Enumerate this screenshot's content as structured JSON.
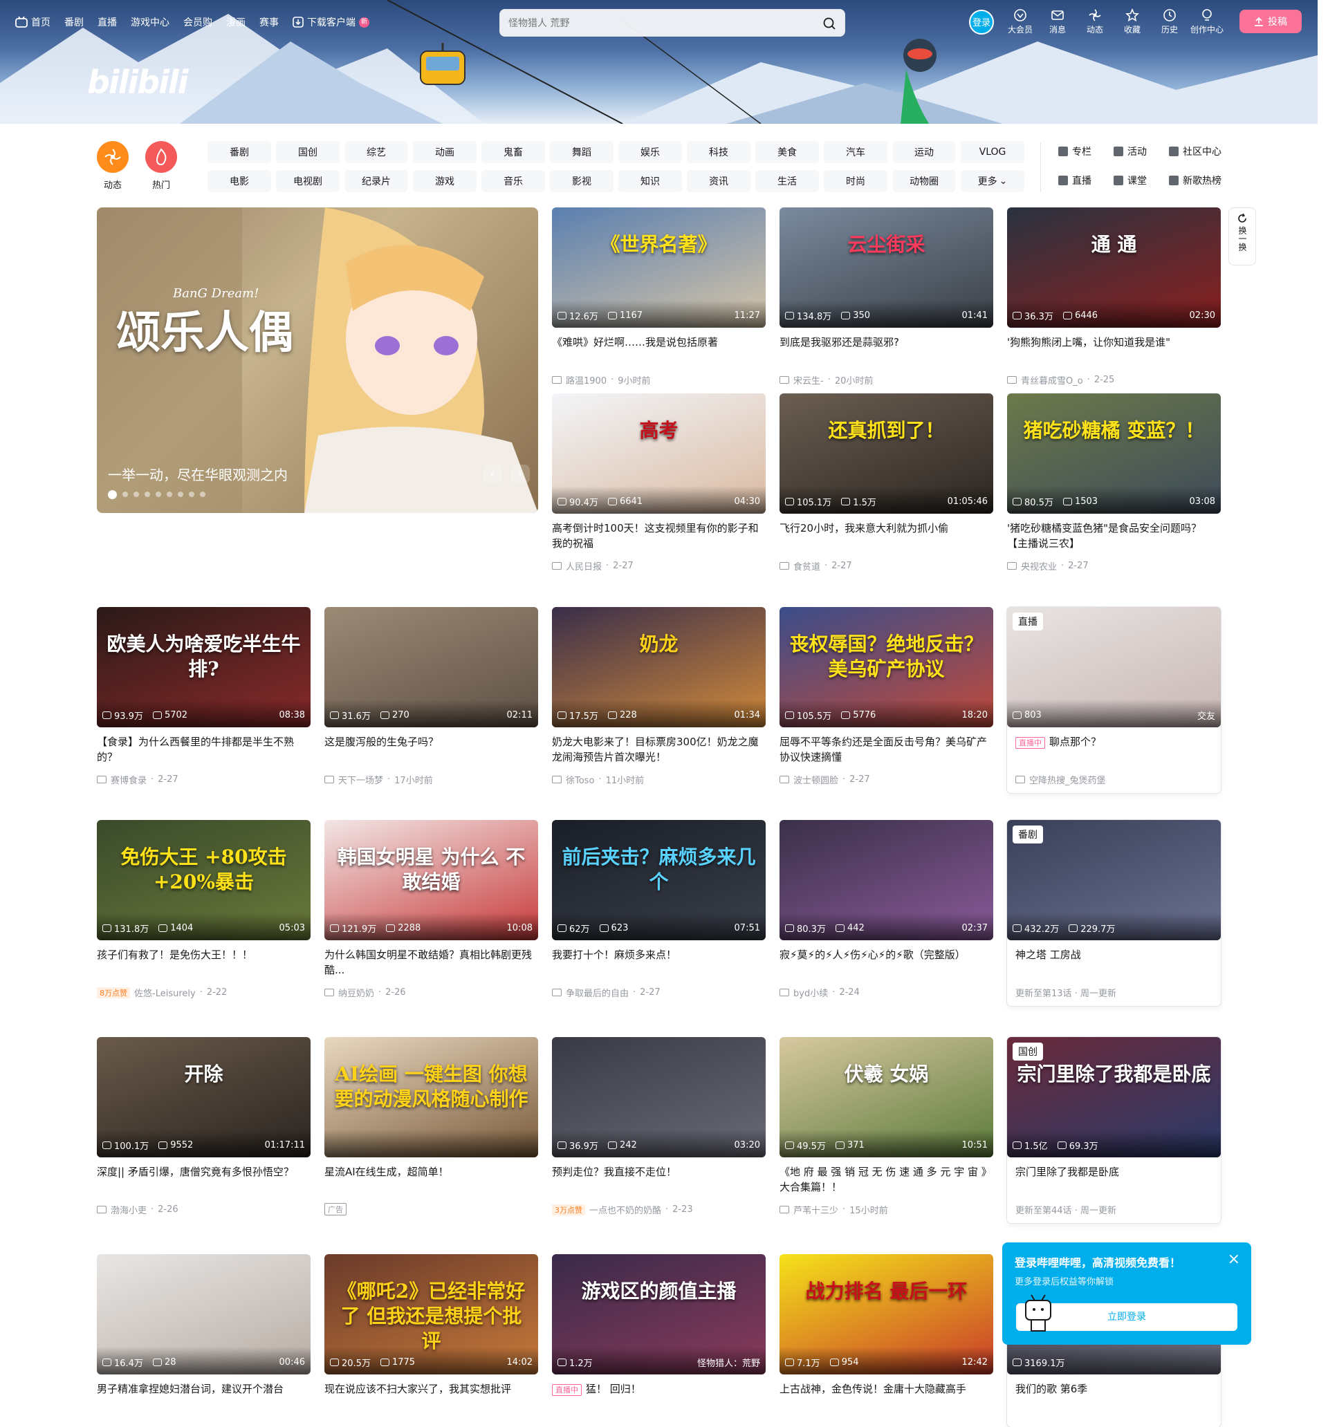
{
  "topnav": {
    "left": [
      {
        "label": "首页",
        "icon": "home-icon"
      },
      {
        "label": "番剧"
      },
      {
        "label": "直播"
      },
      {
        "label": "游戏中心"
      },
      {
        "label": "会员购"
      },
      {
        "label": "漫画"
      },
      {
        "label": "赛事"
      },
      {
        "label": "下载客户端",
        "icon": "download-icon",
        "badge": "新"
      }
    ],
    "search_placeholder": "怪物猎人 荒野",
    "login_label": "登录",
    "right": [
      {
        "label": "大会员",
        "icon": "vip-icon"
      },
      {
        "label": "消息",
        "icon": "message-icon"
      },
      {
        "label": "动态",
        "icon": "dynamic-icon"
      },
      {
        "label": "收藏",
        "icon": "star-icon"
      },
      {
        "label": "历史",
        "icon": "clock-icon"
      },
      {
        "label": "创作中心",
        "icon": "bulb-icon"
      }
    ],
    "upload_label": "投稿",
    "brand_color": "#fb7299",
    "accent_color": "#00aeec"
  },
  "logo": "bilibili",
  "channels": {
    "round": [
      {
        "label": "动态",
        "color": "#ff8c1a"
      },
      {
        "label": "热门",
        "color": "#f55a5a"
      }
    ],
    "grid": [
      "番剧",
      "国创",
      "综艺",
      "动画",
      "鬼畜",
      "舞蹈",
      "娱乐",
      "科技",
      "美食",
      "汽车",
      "运动",
      "VLOG",
      "电影",
      "电视剧",
      "纪录片",
      "游戏",
      "音乐",
      "影视",
      "知识",
      "资讯",
      "生活",
      "时尚",
      "动物圈",
      "更多"
    ],
    "side": [
      "专栏",
      "活动",
      "社区中心",
      "直播",
      "课堂",
      "新歌热榜"
    ]
  },
  "carousel": {
    "title": "一举一动，尽在华眼观测之内",
    "art_title": "颂乐人偶",
    "art_sub": "BanG Dream!"
  },
  "refresh_label": "换一换",
  "cards": [
    {
      "title": "《难哄》好烂啊……我是说包括原著",
      "views": "12.6万",
      "danmaku": "1167",
      "dur": "11:27",
      "up": "路温1900",
      "date": "9小时前",
      "thumb_text": "《世界名著》",
      "bg": [
        "#5a7fb0",
        "#d8c6a8"
      ],
      "tc": "#ffe21a"
    },
    {
      "title": "到底是我驱邪还是蒜驱邪?",
      "views": "134.8万",
      "danmaku": "350",
      "dur": "01:41",
      "up": "宋云生-",
      "date": "20小时前",
      "thumb_text": "云尘街采",
      "bg": [
        "#7a8a9e",
        "#3a3f46"
      ],
      "tc": "#ff3a5c"
    },
    {
      "title": "'狗熊狗熊闭上嘴，让你知道我是谁\"",
      "views": "36.3万",
      "danmaku": "6446",
      "dur": "02:30",
      "up": "青丝暮成雪O_o",
      "date": "2-25",
      "thumb_text": "通 通",
      "bg": [
        "#2a3340",
        "#8b1f1f"
      ],
      "tc": "#ffffff"
    },
    {
      "title": "高考倒计时100天！这支视频里有你的影子和我的祝福",
      "views": "90.4万",
      "danmaku": "6641",
      "dur": "04:30",
      "up": "人民日报",
      "date": "2-27",
      "thumb_text": "高考",
      "bg": [
        "#f3f5f9",
        "#d9b9a0"
      ],
      "tc": "#c4101a"
    },
    {
      "title": "飞行20小时，我来意大利就为抓小偷",
      "views": "105.1万",
      "danmaku": "1.5万",
      "dur": "01:05:46",
      "up": "食贫道",
      "date": "2-27",
      "thumb_text": "还真抓到了！",
      "bg": [
        "#6b5e52",
        "#2c2621"
      ],
      "tc": "#ffe21a"
    },
    {
      "title": "'猪吃砂糖橘变蓝色猪\"是食品安全问题吗？【主播说三农】",
      "views": "80.5万",
      "danmaku": "1503",
      "dur": "03:08",
      "up": "央视农业",
      "date": "2-27",
      "thumb_text": "猪吃砂糖橘 变蓝？！",
      "bg": [
        "#6c7a4a",
        "#3d4a5a"
      ],
      "tc": "#ffe21a"
    },
    {
      "title": "【食录】为什么西餐里的牛排都是半生不熟的？",
      "views": "93.9万",
      "danmaku": "5702",
      "dur": "08:38",
      "up": "赛博食录",
      "date": "2-27",
      "thumb_text": "欧美人为啥爱吃半生牛排?",
      "bg": [
        "#2b1a18",
        "#8a2a2a"
      ],
      "tc": "#ffffff"
    },
    {
      "title": "这是腹泻般的生兔子吗？",
      "views": "31.6万",
      "danmaku": "270",
      "dur": "02:11",
      "up": "天下一场梦",
      "date": "17小时前",
      "thumb_text": "",
      "bg": [
        "#9c8a76",
        "#5e5045"
      ],
      "tc": "#ffffff"
    },
    {
      "title": "奶龙大电影来了！目标票房300亿！奶龙之魔龙闹海预告片首次曝光！",
      "views": "17.5万",
      "danmaku": "228",
      "dur": "01:34",
      "up": "徐Toso",
      "date": "11小时前",
      "thumb_text": "奶龙",
      "bg": [
        "#3a2e4a",
        "#d28a3a"
      ],
      "tc": "#ffd21a"
    },
    {
      "title": "屈辱不平等条约还是全面反击号角？美乌矿产协议快速摘懂",
      "views": "105.5万",
      "danmaku": "5776",
      "dur": "18:20",
      "up": "波士顿圆脸",
      "date": "2-27",
      "thumb_text": "丧权辱国？绝地反击？ 美乌矿产协议",
      "bg": [
        "#3b4d8a",
        "#c24a3a"
      ],
      "tc": "#ffe21a"
    },
    {
      "title": "聊点那个？",
      "views": "803",
      "danmaku": "",
      "dur": "交友",
      "up": "空降热搜_兔煲药堡",
      "date": "",
      "thumb_text": "",
      "bg": [
        "#e8e4e2",
        "#c8b6b4"
      ],
      "tc": "#ffffff",
      "badge": "直播",
      "live": "直播中",
      "boxed": true
    },
    {
      "title": "孩子们有救了！是免伤大王！！！",
      "views": "131.8万",
      "danmaku": "1404",
      "dur": "05:03",
      "up": "佐悠-Leisurely",
      "date": "2-22",
      "thumb_text": "免伤大王 +80攻击 +20%暴击",
      "bg": [
        "#3a4a2a",
        "#6a7a3a"
      ],
      "tc": "#ffe21a",
      "tag": "8万点赞"
    },
    {
      "title": "为什么韩国女明星不敢结婚？真相比韩剧更残酷...",
      "views": "121.9万",
      "danmaku": "2288",
      "dur": "10:08",
      "up": "纳豆奶奶",
      "date": "2-26",
      "thumb_text": "韩国女明星 为什么 不敢结婚",
      "bg": [
        "#f2e6e6",
        "#c83a3a"
      ],
      "tc": "#ffffff"
    },
    {
      "title": "我要打十个！麻烦多来点！",
      "views": "62万",
      "danmaku": "623",
      "dur": "07:51",
      "up": "争取最后的自由",
      "date": "2-27",
      "thumb_text": "前后夹击？麻烦多来几个",
      "bg": [
        "#1a1e26",
        "#3a3f4a"
      ],
      "tc": "#5ad2ff"
    },
    {
      "title": "寂⚡莫⚡的⚡人⚡伤⚡心⚡的⚡歌（完整版）",
      "views": "80.3万",
      "danmaku": "442",
      "dur": "02:37",
      "up": "byd小续",
      "date": "2-24",
      "thumb_text": "",
      "bg": [
        "#3a3048",
        "#8a5a9a"
      ],
      "tc": "#ffffff"
    },
    {
      "title": "神之塔 工房战",
      "views": "432.2万",
      "danmaku": "229.7万",
      "dur": "",
      "up": "更新至第13话 · 周一更新",
      "date": "",
      "thumb_text": "",
      "bg": [
        "#3a4058",
        "#6a7090"
      ],
      "tc": "#ffffff",
      "badge": "番剧",
      "boxed": true,
      "nolabel": true
    },
    {
      "title": "深度|| 矛盾引爆，唐僧究竟有多恨孙悟空？",
      "views": "100.1万",
      "danmaku": "9552",
      "dur": "01:17:11",
      "up": "渤海小吏",
      "date": "2-26",
      "thumb_text": "开除",
      "bg": [
        "#6a5a4a",
        "#2a2420"
      ],
      "tc": "#ffffff"
    },
    {
      "title": "星流AI在线生成，超简单！",
      "views": "",
      "danmaku": "",
      "dur": "",
      "up": "",
      "date": "",
      "thumb_text": "AI绘画 一键生图 你想要的动漫风格随心制作",
      "bg": [
        "#e8d8c0",
        "#7a5a3a"
      ],
      "tc": "#ffd21a",
      "ad": "广告"
    },
    {
      "title": "预判走位？我直接不走位！",
      "views": "36.9万",
      "danmaku": "242",
      "dur": "03:20",
      "up": "一点也不奶的奶酪",
      "date": "2-23",
      "thumb_text": "",
      "bg": [
        "#3a3a44",
        "#6a6a78"
      ],
      "tc": "#ffffff",
      "tag": "3万点赞"
    },
    {
      "title": "《地 府 最 强 销 冠 无 伤 速 通 多 元 宇 宙 》大合集篇！！",
      "views": "49.5万",
      "danmaku": "371",
      "dur": "10:51",
      "up": "芦苇十三少",
      "date": "15小时前",
      "thumb_text": "伏羲 女娲",
      "bg": [
        "#d8c8a0",
        "#5a7a3a"
      ],
      "tc": "#ffffff"
    },
    {
      "title": "宗门里除了我都是卧底",
      "views": "1.5亿",
      "danmaku": "69.3万",
      "dur": "",
      "up": "更新至第44话 · 周一更新",
      "date": "",
      "thumb_text": "宗门里除了我都是卧底",
      "bg": [
        "#6a2a3a",
        "#2a3a6a"
      ],
      "tc": "#ffffff",
      "badge": "国创",
      "boxed": true,
      "nolabel": true
    },
    {
      "title": "男子精准拿捏媳妇潜台词，建议开个潜台",
      "views": "16.4万",
      "danmaku": "28",
      "dur": "00:46",
      "up": "",
      "date": "",
      "thumb_text": "",
      "bg": [
        "#e8e6e4",
        "#b8aca4"
      ],
      "tc": "#ffffff"
    },
    {
      "title": "现在说应该不扫大家兴了，我其实想批评",
      "views": "20.5万",
      "danmaku": "1775",
      "dur": "14:02",
      "up": "",
      "date": "",
      "thumb_text": "《哪吒2》已经非常好了 但我还是想提个批评",
      "bg": [
        "#6a3a2a",
        "#c87a3a"
      ],
      "tc": "#ffd21a"
    },
    {
      "title": "猛！ 回归！",
      "views": "1.2万",
      "danmaku": "",
      "dur": "怪物猎人：荒野",
      "up": "",
      "date": "",
      "thumb_text": "游戏区的颜值主播",
      "bg": [
        "#3a2a4a",
        "#8a3a5a"
      ],
      "tc": "#ffffff",
      "live": "直播中"
    },
    {
      "title": "上古战神，金色传说！金庸十大隐藏高手",
      "views": "7.1万",
      "danmaku": "954",
      "dur": "12:42",
      "up": "",
      "date": "",
      "thumb_text": "战力排名 最后一环",
      "bg": [
        "#f5e21a",
        "#c83a2a"
      ],
      "tc": "#c8101a"
    },
    {
      "title": "我们的歌 第6季",
      "views": "3169.1万",
      "danmaku": "",
      "dur": "",
      "up": "",
      "date": "",
      "thumb_text": "",
      "bg": [
        "#3a3a4a",
        "#6a6a7a"
      ],
      "tc": "#ffffff",
      "boxed": true
    }
  ],
  "popup": {
    "title": "登录哔哩哔哩，高清视频免费看！",
    "sub": "更多登录后权益等你解锁",
    "button": "立即登录"
  }
}
